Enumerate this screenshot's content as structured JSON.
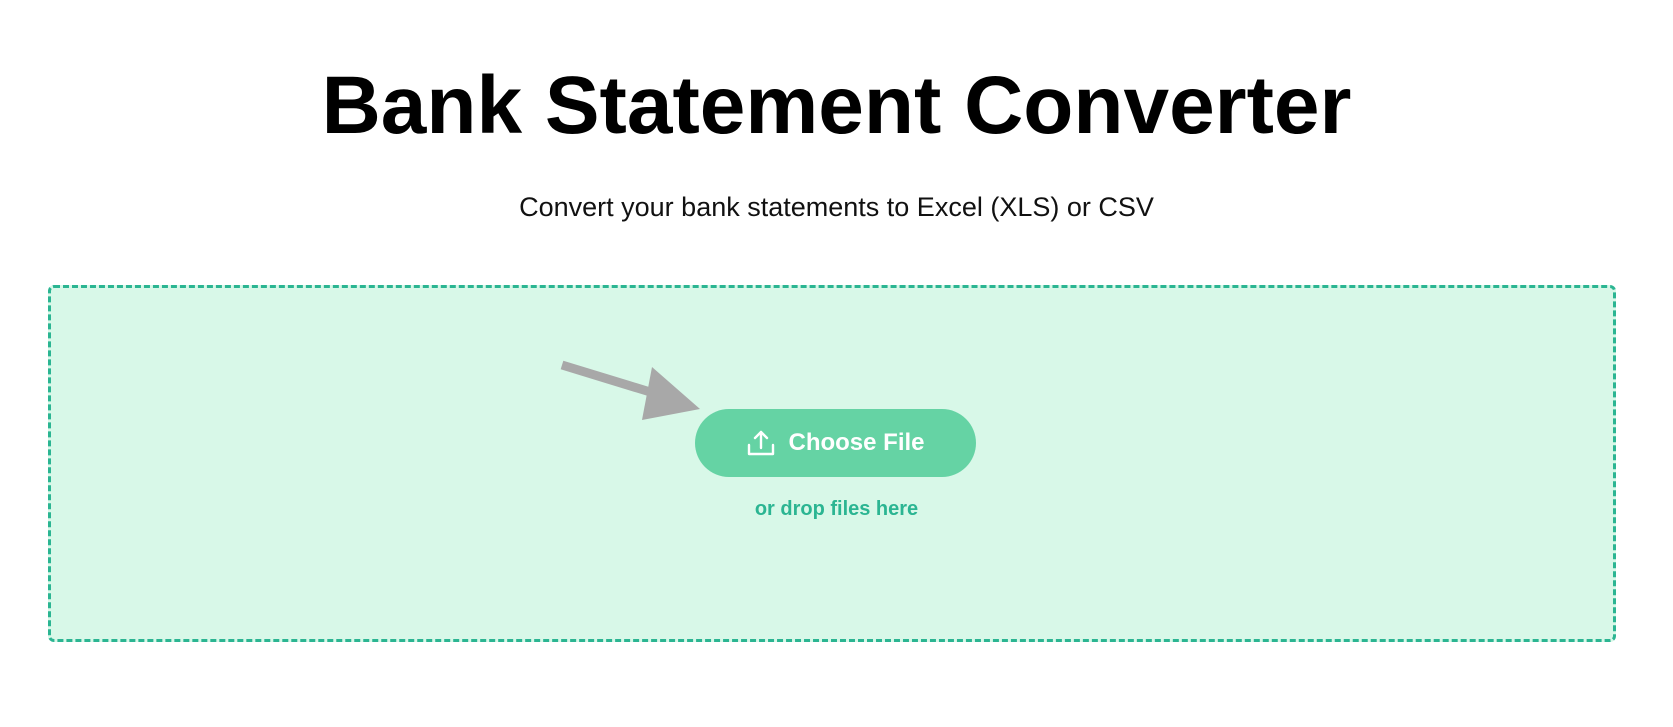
{
  "header": {
    "title": "Bank Statement Converter",
    "subtitle": "Convert your bank statements to Excel (XLS) or CSV"
  },
  "upload": {
    "button_label": "Choose File",
    "button_icon": "upload-icon",
    "drop_hint": "or drop files here",
    "pointer_icon": "arrow-pointer-icon"
  },
  "colors": {
    "dropzone_background": "#d8f8e8",
    "dropzone_border": "#2bb592",
    "button_background": "#65d3a4",
    "hint_text": "#2bb592",
    "arrow": "#a8a8a8"
  }
}
